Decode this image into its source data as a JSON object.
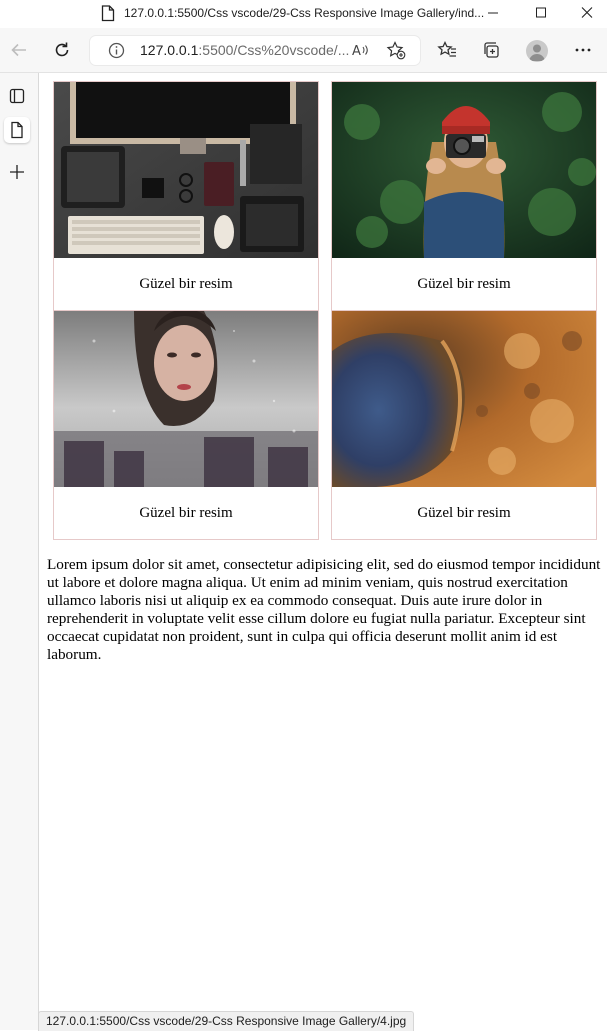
{
  "window": {
    "title": "127.0.0.1:5500/Css vscode/29-Css Responsive Image Gallery/ind..."
  },
  "toolbar": {
    "url_host": "127.0.0.1",
    "url_path": ":5500/Css%20vscode/..."
  },
  "gallery": {
    "items": [
      {
        "caption": "Güzel bir resim",
        "image": "desk-workspace"
      },
      {
        "caption": "Güzel bir resim",
        "image": "woman-with-camera"
      },
      {
        "caption": "Güzel bir resim",
        "image": "woman-behind-glass"
      },
      {
        "caption": "Güzel bir resim",
        "image": "crater-aerial"
      }
    ]
  },
  "content": {
    "paragraph": "Lorem ipsum dolor sit amet, consectetur adipisicing elit, sed do eiusmod tempor incididunt ut labore et dolore magna aliqua. Ut enim ad minim veniam, quis nostrud exercitation ullamco laboris nisi ut aliquip ex ea commodo consequat. Duis aute irure dolor in reprehenderit in voluptate velit esse cillum dolore eu fugiat nulla pariatur. Excepteur sint occaecat cupidatat non proident, sunt in culpa qui officia deserunt mollit anim id est laborum."
  },
  "status": {
    "link": "127.0.0.1:5500/Css vscode/29-Css Responsive Image Gallery/4.jpg"
  },
  "colors": {
    "chrome": "#f7f7f7",
    "gallery_border": "#e6c9c9"
  }
}
